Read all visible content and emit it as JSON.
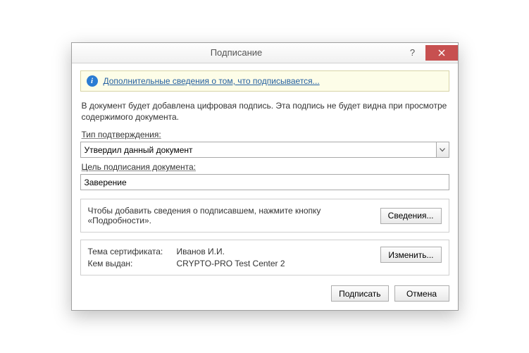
{
  "titlebar": {
    "title": "Подписание",
    "help": "?",
    "close": "×"
  },
  "info": {
    "link_text": "Дополнительные сведения о том, что подписывается..."
  },
  "description": "В документ будет добавлена цифровая подпись. Эта подпись не будет видна при просмотре содержимого документа.",
  "fields": {
    "type_label": "Тип подтверждения:",
    "type_value": "Утвердил данный документ",
    "purpose_label": "Цель подписания документа:",
    "purpose_value": "Заверение"
  },
  "details_panel": {
    "text": "Чтобы добавить сведения о подписавшем, нажмите кнопку «Подробности».",
    "button": "Сведения..."
  },
  "cert": {
    "subject_label": "Тема сертификата:",
    "subject_value": "Иванов И.И.",
    "issuer_label": "Кем выдан:",
    "issuer_value": "CRYPTO-PRO Test Center 2",
    "button": "Изменить..."
  },
  "footer": {
    "sign": "Подписать",
    "cancel": "Отмена"
  }
}
